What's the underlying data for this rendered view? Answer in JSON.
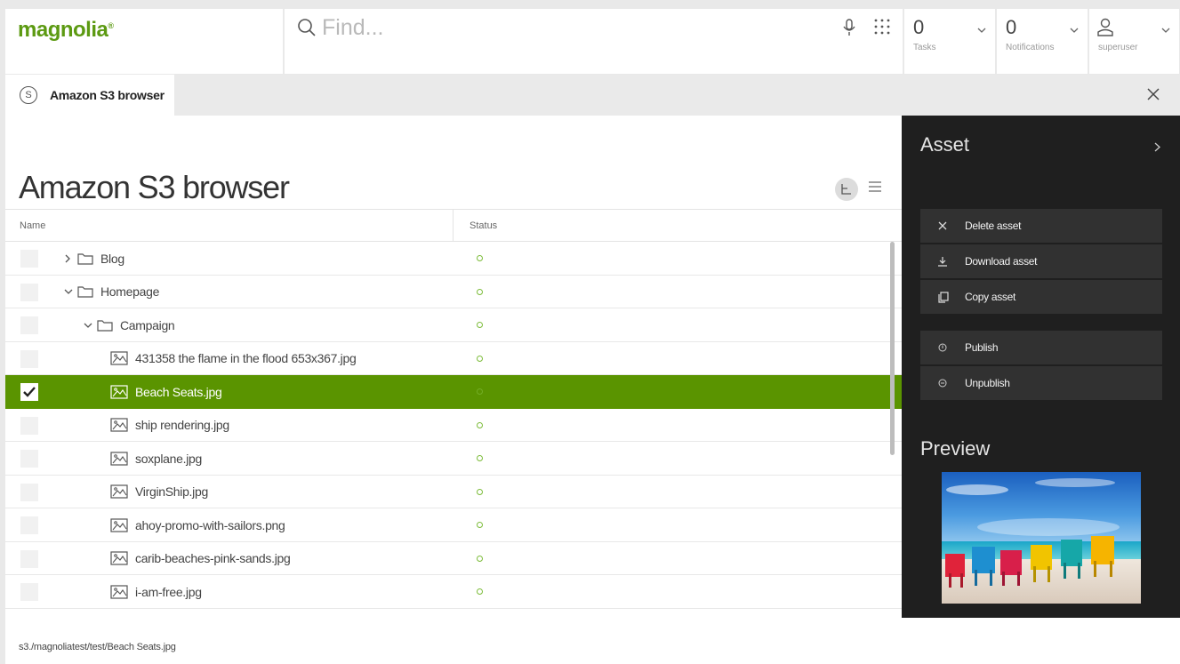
{
  "header": {
    "logo_text": "magnolia",
    "logo_mark": "®",
    "search_placeholder": "Find...",
    "tasks": {
      "count": "0",
      "label": "Tasks"
    },
    "notifications": {
      "count": "0",
      "label": "Notifications"
    },
    "user": {
      "label": "superuser"
    },
    "brand_color": "#5c9a12"
  },
  "tab": {
    "icon_letter": "S",
    "label": "Amazon S3 browser"
  },
  "page": {
    "title": "Amazon S3 browser"
  },
  "table": {
    "columns": [
      "Name",
      "Status"
    ],
    "rows": [
      {
        "label": "Blog",
        "type": "folder",
        "expanded": false,
        "level": 0,
        "selected": false
      },
      {
        "label": "Homepage",
        "type": "folder",
        "expanded": true,
        "level": 0,
        "selected": false
      },
      {
        "label": "Campaign",
        "type": "folder",
        "expanded": true,
        "level": 1,
        "selected": false
      },
      {
        "label": "431358 the flame in the flood 653x367.jpg",
        "type": "image",
        "level": 2,
        "selected": false
      },
      {
        "label": "Beach Seats.jpg",
        "type": "image",
        "level": 2,
        "selected": true
      },
      {
        "label": "ship rendering.jpg",
        "type": "image",
        "level": 2,
        "selected": false
      },
      {
        "label": "soxplane.jpg",
        "type": "image",
        "level": 2,
        "selected": false
      },
      {
        "label": "VirginShip.jpg",
        "type": "image",
        "level": 2,
        "selected": false
      },
      {
        "label": "ahoy-promo-with-sailors.png",
        "type": "image",
        "level": 2,
        "selected": false
      },
      {
        "label": "carib-beaches-pink-sands.jpg",
        "type": "image",
        "level": 2,
        "selected": false
      },
      {
        "label": "i-am-free.jpg",
        "type": "image",
        "level": 2,
        "selected": false
      }
    ],
    "selected_color": "#5a9400",
    "status_color": "#7cbc3a"
  },
  "footer": {
    "path": "s3./magnoliatest/test/Beach Seats.jpg"
  },
  "actions": {
    "title": "Asset",
    "items": [
      {
        "label": "Delete asset",
        "icon": "close-icon"
      },
      {
        "label": "Download asset",
        "icon": "download-icon"
      },
      {
        "label": "Copy asset",
        "icon": "copy-icon"
      },
      {
        "label": "Publish",
        "icon": "publish-icon"
      },
      {
        "label": "Unpublish",
        "icon": "unpublish-icon"
      }
    ],
    "preview_title": "Preview"
  }
}
